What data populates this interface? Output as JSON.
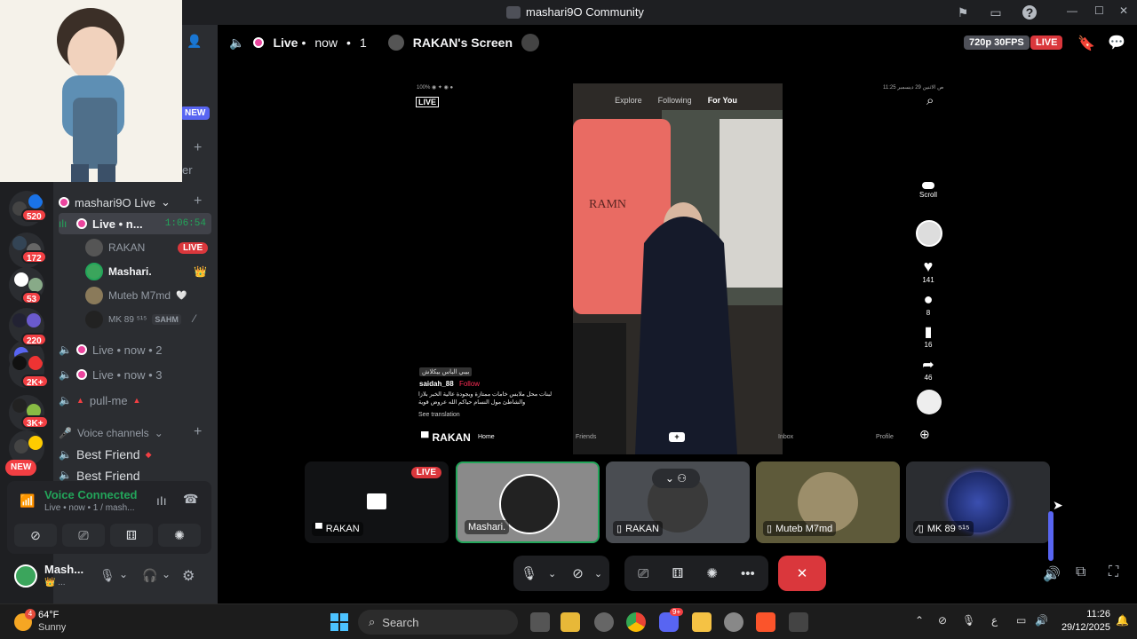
{
  "window": {
    "title": "mashari9O Community"
  },
  "stage_header": {
    "live_label": "Live",
    "time": "now",
    "viewers": "1",
    "screen_title": "RAKAN's Screen",
    "quality": "720p 30FPS",
    "live_pill": "LIVE"
  },
  "channels": {
    "category_live": "mashari9O Live",
    "active_channel": "Live • n...",
    "active_timer": "1:06:54",
    "members": [
      {
        "name": "RAKAN",
        "badge": "LIVE"
      },
      {
        "name": "Mashari.",
        "badge": "👑"
      },
      {
        "name": "Muteb M7md",
        "badge": ""
      },
      {
        "name": "MK 89 ⁵¹⁵",
        "badge": "SAHM"
      }
    ],
    "live2": "Live • now • 2",
    "live3": "Live • now • 3",
    "pull": "pull-me",
    "voice_category": "Voice channels",
    "best_friend": "Best Friend",
    "best_friend2": "Best Friend",
    "new_badge": "NEW",
    "other_text": "er"
  },
  "servers": [
    {
      "badge": "520"
    },
    {
      "badge": "172"
    },
    {
      "badge": ""
    },
    {
      "badge": "53"
    },
    {
      "badge": "220"
    },
    {
      "badge": ""
    },
    {
      "badge": "2K+"
    },
    {
      "badge": ""
    },
    {
      "badge": "3K+"
    },
    {
      "badge": ""
    }
  ],
  "server_new": "NEW",
  "voice_panel": {
    "status": "Voice Connected",
    "sub": "Live • now • 1 / mash..."
  },
  "user_panel": {
    "name": "Mash...",
    "status": "👑 ..."
  },
  "tiktok": {
    "tabs": [
      "Explore",
      "Following",
      "For You"
    ],
    "live_label": "LIVE",
    "username": "saidah_88",
    "follow": "Follow",
    "caption": "لبنات محل ملابس خامات ممتازة وبجودة عالية الخبر بلازا والشاطئ مول النسام حياكم الله عروض قوية",
    "see_translation": "See translation",
    "hashtag": "بيبي الباس بيكلاش",
    "counts": [
      "141",
      "8",
      "16",
      "46"
    ],
    "scroll": "Scroll",
    "nav": [
      "Home",
      "Friends",
      "Inbox",
      "Profile"
    ],
    "caption_header_time": "11:25 ص الاثنين 29 ديسمبر",
    "streamer_tag": "RAKAN"
  },
  "tiles": [
    {
      "name": "RAKAN",
      "live": "LIVE"
    },
    {
      "name": "Mashari."
    },
    {
      "name": "RAKAN"
    },
    {
      "name": "Muteb M7md"
    },
    {
      "name": "MK 89 ⁵¹⁵"
    }
  ],
  "taskbar": {
    "weather_temp": "64°F",
    "weather_desc": "Sunny",
    "weather_badge": "4",
    "search": "Search",
    "time": "11:26",
    "date": "29/12/2025",
    "lang": "ع",
    "discord_badge": "9+"
  }
}
